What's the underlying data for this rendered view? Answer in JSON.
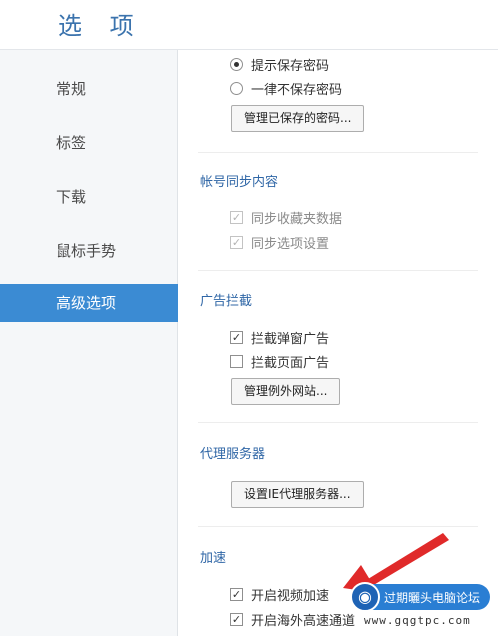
{
  "header": {
    "title": "选 项"
  },
  "sidebar": {
    "items": [
      {
        "label": "常规"
      },
      {
        "label": "标签"
      },
      {
        "label": "下载"
      },
      {
        "label": "鼠标手势"
      },
      {
        "label": "高级选项",
        "active": true
      }
    ]
  },
  "password": {
    "options": [
      {
        "label": "提示保存密码",
        "selected": true
      },
      {
        "label": "一律不保存密码",
        "selected": false
      }
    ],
    "manage_button": "管理已保存的密码..."
  },
  "sync": {
    "title": "帐号同步内容",
    "options": [
      {
        "label": "同步收藏夹数据",
        "checked": true,
        "disabled": true
      },
      {
        "label": "同步选项设置",
        "checked": true,
        "disabled": true
      }
    ]
  },
  "adblock": {
    "title": "广告拦截",
    "options": [
      {
        "label": "拦截弹窗广告",
        "checked": true
      },
      {
        "label": "拦截页面广告",
        "checked": false
      }
    ],
    "manage_button": "管理例外网站..."
  },
  "proxy": {
    "title": "代理服务器",
    "button": "设置IE代理服务器..."
  },
  "accel": {
    "title": "加速",
    "options": [
      {
        "label": "开启视频加速",
        "checked": true
      },
      {
        "label": "开启海外高速通道",
        "checked": true
      }
    ]
  },
  "annotation": {
    "color": "#e02a2a"
  },
  "watermark": {
    "text": "过期曬头电脑论坛",
    "url": "www.gqgtpc.com"
  },
  "colors": {
    "accent": "#3b8bd3",
    "title": "#3b73ad",
    "section": "#2f66a6"
  }
}
